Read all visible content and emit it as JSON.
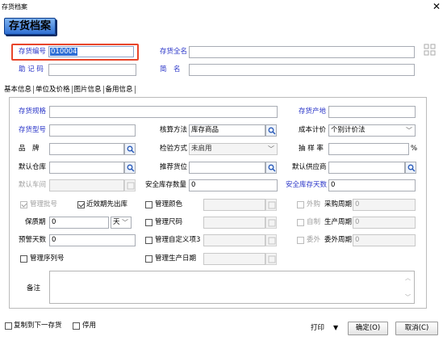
{
  "window": {
    "title": "存货档案",
    "close_glyph": "✕"
  },
  "header": {
    "badge": "存货档案"
  },
  "top": {
    "code_label": "存货编号",
    "code_value": "010004",
    "fullname_label": "存货全名",
    "fullname_value": "",
    "mnemonic_label": "助 记 码",
    "mnemonic_value": "",
    "short_label": "简　名",
    "short_value": ""
  },
  "tabs": [
    {
      "label": "基本信息"
    },
    {
      "label": "单位及价格"
    },
    {
      "label": "图片信息"
    },
    {
      "label": "备用信息"
    }
  ],
  "form": {
    "spec_label": "存货规格",
    "spec_value": "",
    "origin_label": "存货产地",
    "origin_value": "",
    "model_label": "存货型号",
    "model_value": "",
    "account_label": "核算方法",
    "account_value": "库存商品",
    "cost_label": "成本计价",
    "cost_value": "个别计价法",
    "brand_label": "品　牌",
    "brand_value": "",
    "inspect_label": "检验方式",
    "inspect_value": "未启用",
    "sample_label": "抽 样 率",
    "sample_value": "",
    "sample_unit": "%",
    "warehouse_label": "默认仓库",
    "warehouse_value": "",
    "slot_label": "推荐货位",
    "slot_value": "",
    "supplier_label": "默认供应商",
    "supplier_value": "",
    "workshop_label": "默认车间",
    "workshop_value": "",
    "safe_qty_label": "安全库存数量",
    "safe_qty_value": "0",
    "safe_days_label": "安全库存天数",
    "safe_days_value": "0",
    "batch_label": "管理批号",
    "fifo_label": "近效期先出库",
    "color_label": "管理颜色",
    "color_value": "",
    "outsource_label": "外购",
    "purchase_cycle_label": "采购周期",
    "purchase_cycle_value": "0",
    "shelf_label": "保质期",
    "shelf_value": "0",
    "shelf_unit": "天",
    "size_label": "管理尺码",
    "size_value": "",
    "selfmade_label": "自制",
    "produce_cycle_label": "生产周期",
    "produce_cycle_value": "0",
    "warn_label": "预警天数",
    "warn_value": "0",
    "custom_label": "管理自定义项3",
    "custom_value": "",
    "consign_label": "委外",
    "consign_cycle_label": "委外周期",
    "consign_cycle_value": "0",
    "serial_label": "管理序列号",
    "proddate_label": "管理生产日期",
    "proddate_value": "",
    "remark_label": "备注",
    "remark_value": ""
  },
  "footer": {
    "copy_label": "复制到下一存货",
    "disable_label": "停用",
    "print_label": "打印",
    "print_arrow": "▼",
    "ok_label": "确定(O)",
    "cancel_label": "取消(C)"
  },
  "colors": {
    "accent_blue": "#2a35c8",
    "highlight_red": "#e8452a",
    "badge": "#2f6fd3"
  }
}
